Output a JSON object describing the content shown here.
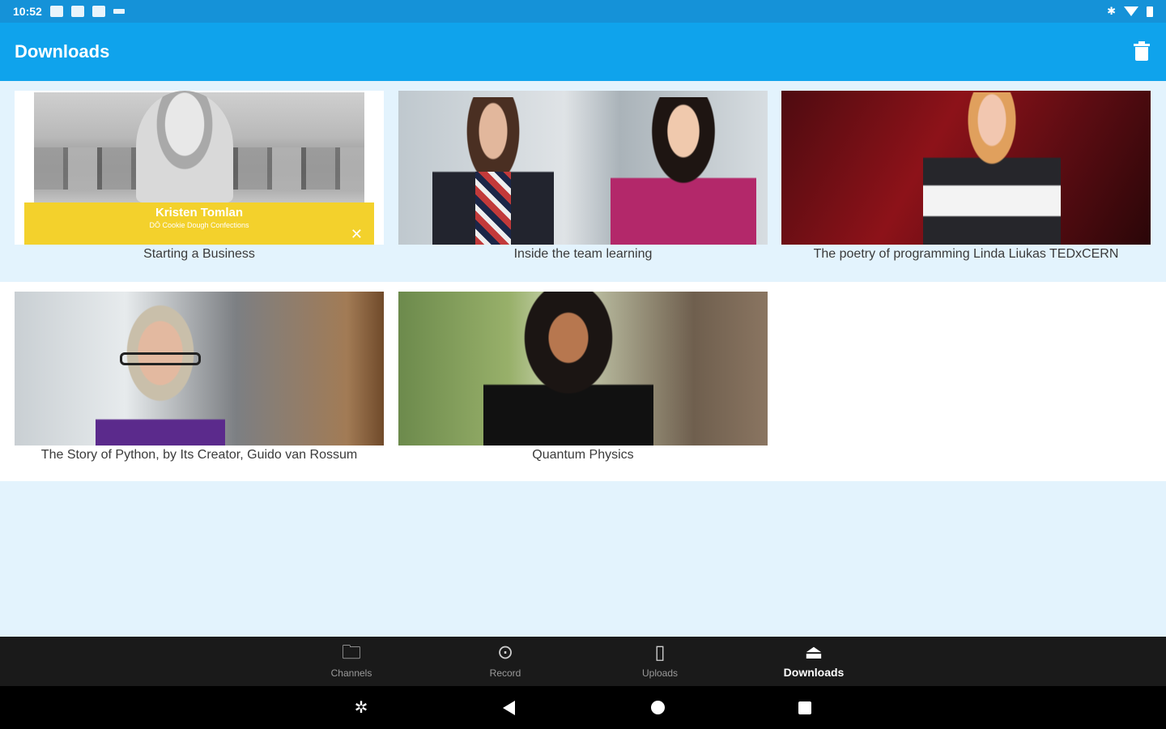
{
  "status_bar": {
    "time": "10:52",
    "icons": [
      "notification-icon",
      "calendar-icon",
      "calendar-icon",
      "signal-icon",
      "bluetooth-icon",
      "wifi-icon",
      "battery-icon"
    ]
  },
  "app_bar": {
    "title": "Downloads",
    "delete_icon": "trash-icon"
  },
  "videos": [
    {
      "title": "Starting a Business",
      "banner_name": "Kristen Tomlan",
      "banner_sub": "DŌ Cookie Dough Confections"
    },
    {
      "title": "Inside the team learning"
    },
    {
      "title": "The poetry of programming Linda Liukas TEDxCERN"
    },
    {
      "title": "The Story of Python, by Its Creator, Guido van Rossum"
    },
    {
      "title": "Quantum Physics"
    }
  ],
  "bottom_nav": {
    "items": [
      {
        "label": "Channels",
        "icon": "folder-icon"
      },
      {
        "label": "Record",
        "icon": "record-icon"
      },
      {
        "label": "Uploads",
        "icon": "upload-file-icon"
      },
      {
        "label": "Downloads",
        "icon": "download-tray-icon",
        "active": true
      }
    ]
  },
  "colors": {
    "status_bar": "#1592d8",
    "app_bar": "#0fa3ec",
    "background": "#e3f3fd",
    "bottom_nav": "#1a1a1a"
  }
}
